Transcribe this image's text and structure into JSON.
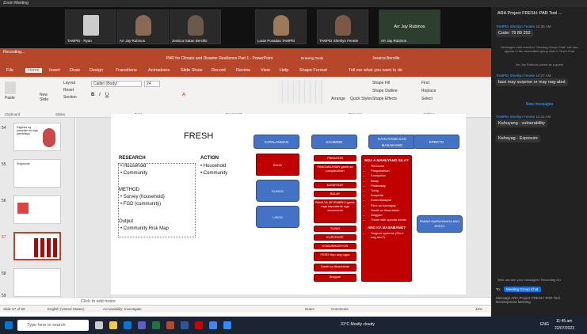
{
  "zoom": {
    "title": "Zoom Meeting"
  },
  "video": {
    "tiles": [
      {
        "name": "TAMPEI - Ryan"
      },
      {
        "name": "Arr Jay Rubinos"
      },
      {
        "name": "Jessica Gatan Bercillo"
      },
      {
        "name": "Louie Posadas TAMPEI"
      },
      {
        "name": "TAMPEI Sherilyn Fenete"
      },
      {
        "name": "Arr Jay Rubinos",
        "big": "Arr Jay Rubinos"
      }
    ],
    "recording": "Recording..."
  },
  "ppt": {
    "title": "PAR for Climate and Disaster Resilience Part 1 - PowerPoint",
    "drawing_tools": "Drawing Tools",
    "user": "Jessica Bercillo",
    "tabs": [
      "File",
      "Home",
      "Insert",
      "Draw",
      "Design",
      "Transitions",
      "Animations",
      "Slide Show",
      "Record",
      "Review",
      "View",
      "Help",
      "Shape Format"
    ],
    "tell_me": "Tell me what you want to do",
    "ribbon": {
      "paste": "Paste",
      "layout": "Layout",
      "reset": "Reset",
      "new_slide": "New Slide",
      "section": "Section",
      "font": "Calibri (Body)",
      "size": "24",
      "groups": [
        "Clipboard",
        "Slides",
        "Font",
        "Paragraph",
        "Drawing",
        "Editing"
      ],
      "arrange": "Arrange",
      "quick_styles": "Quick Styles",
      "shape_fill": "Shape Fill",
      "shape_outline": "Shape Outline",
      "shape_effects": "Shape Effects",
      "find": "Find",
      "replace": "Replace",
      "select": "Select"
    },
    "thumbs": [
      {
        "num": "54",
        "text": "Pagkilos ng pasaulan sa mga pandaraya"
      },
      {
        "num": "55",
        "text": "Snapshots"
      },
      {
        "num": "56",
        "text": ""
      },
      {
        "num": "57",
        "text": ""
      },
      {
        "num": "58",
        "text": ""
      },
      {
        "num": "59",
        "text": ""
      }
    ],
    "notes": "Click to add notes",
    "status": {
      "slide": "Slide 57 of 59",
      "lang": "English (United States)",
      "accessibility": "Accessibility: Investigate",
      "notes": "Notes",
      "comments": "Comments",
      "zoom": "46%"
    }
  },
  "slide": {
    "title": "FRESH",
    "research": "RESEARCH",
    "research_items": [
      "Household",
      "Community"
    ],
    "action": "ACTION",
    "action_items": [
      "Household",
      "Community"
    ],
    "method": "METHOD",
    "method_items": [
      "Survey (household)",
      "FGD (community)"
    ],
    "output": "Output",
    "output_items": [
      "Community Risk Map"
    ],
    "headers": [
      "KATALAGMAN",
      "KAHIMNG",
      "KAHUYANG KAG MASAKAING",
      "EPEKTO"
    ],
    "col1": [
      "BAHA",
      "SUNOG",
      "LINOG"
    ],
    "col2": [
      "PANAHON",
      "PANGABUHIAN gamit sa pangabuhian",
      "KASAYSAY",
      "BALAY",
      "PAMILYA MIYEMBRO gamit, mga importante nga documents",
      "TUBIG",
      "KURYENTE",
      "KOMUNIKASYON",
      "FEED biyo ang ugpa",
      "Gastit sa tikaedahan",
      "Alagyan"
    ],
    "col3_title": "NGA A MAHUYANG SILA?",
    "col3_items": [
      "Timescon",
      "Pangabuhian",
      "Kasayatan",
      "Balay",
      "Pastmatay",
      "Tubig",
      "Kuryente",
      "Komunikasyon",
      "Files sa barangay",
      "Gastit sa tikaedahan",
      "Alagyan",
      "Those with special needs"
    ],
    "col3_sub": "ANO KA MASABANG?",
    "col3_sub_items": [
      "Support systems (Sin o bag ano?)"
    ],
    "col4": [
      "PAANO MAPAHINAGA ANG RISGO"
    ]
  },
  "chat": {
    "title": "ARA Project FRESH: PAR Tool ...",
    "messages": [
      {
        "sender": "TAMPEI Sherilyn Fenete",
        "time": "10:35 AM",
        "text": "Code: 79 89 252"
      },
      {
        "sender": "",
        "time": "",
        "text": "Messages addressed to \"Meeting Group Chat\" will also appear in the associated group chat in Team Chat"
      },
      {
        "sender": "",
        "time": "",
        "text": "Arr Jay Rubinos joined as a guest"
      },
      {
        "sender": "TAMPEI Sherilyn Fenete",
        "time": "10:37 AM",
        "text": "basi may surprise or may nag-abot"
      },
      {
        "sender": "",
        "time": "",
        "text": "New messages"
      },
      {
        "sender": "TAMPEI Sherilyn Fenete",
        "time": "11:41 AM",
        "text": "Kahuyang - vulnerability"
      },
      {
        "sender": "",
        "time": "",
        "text": "Kahayag - Exposure"
      }
    ],
    "who_can_see": "Who can see your messages? Recording On",
    "to_label": "To:",
    "to_value": "Meeting Group Chat",
    "input_placeholder": "Message ARA Project FRESH: PAR Tool Development Meeting"
  },
  "taskbar": {
    "search": "Type here to search",
    "weather": "31°C  Mostly cloudy",
    "lang": "ENG",
    "time": "11:45 am",
    "date": "22/07/2023"
  }
}
